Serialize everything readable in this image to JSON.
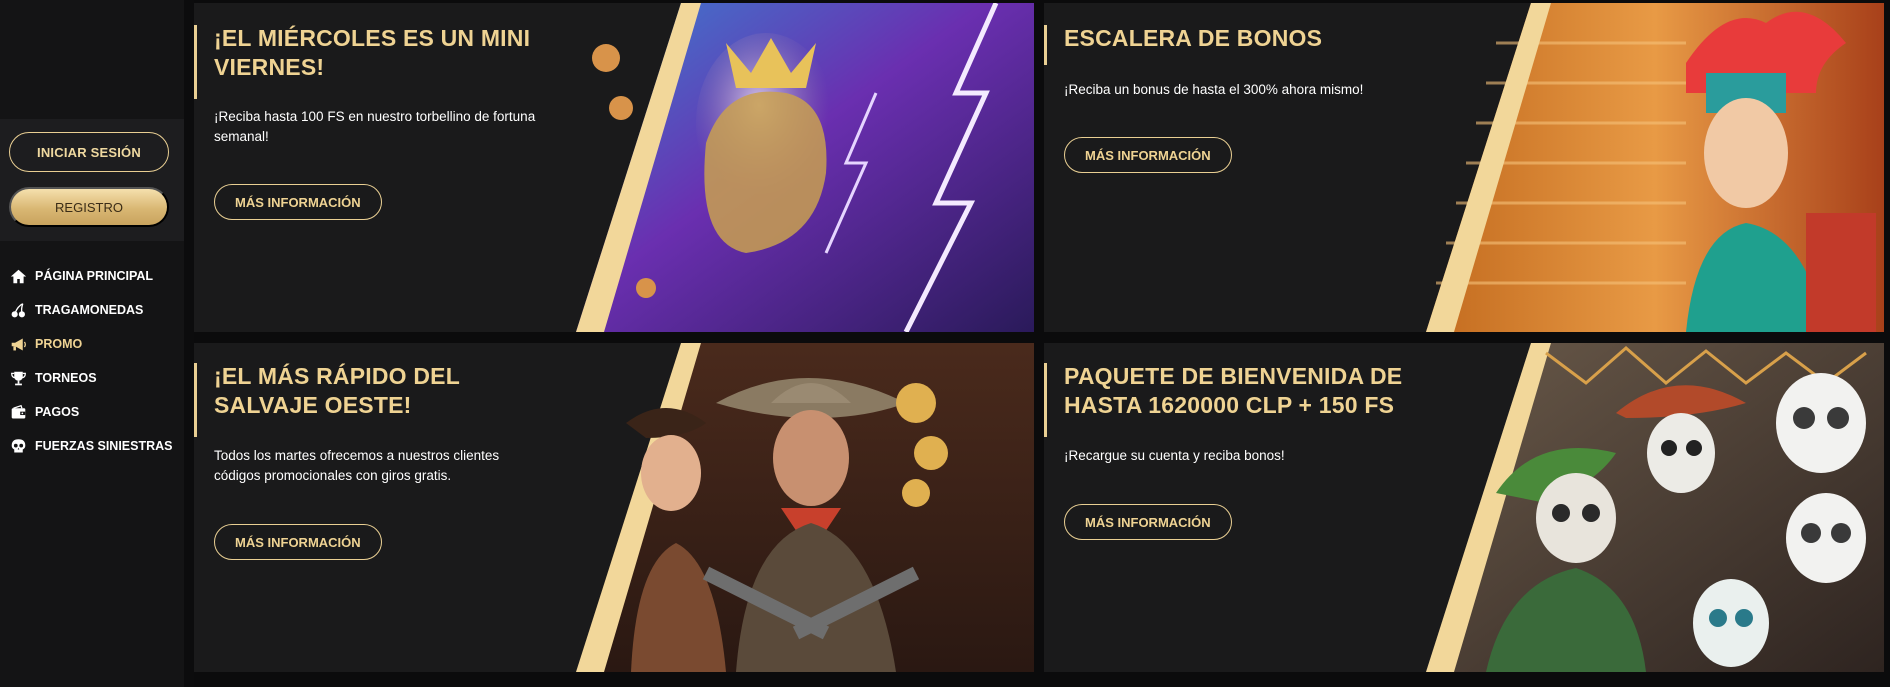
{
  "sidebar": {
    "login_label": "INICIAR SESIÓN",
    "register_label": "REGISTRO",
    "nav": [
      {
        "label": "PÁGINA PRINCIPAL",
        "icon": "home-icon",
        "active": false
      },
      {
        "label": "TRAGAMONEDAS",
        "icon": "cherries-icon",
        "active": false
      },
      {
        "label": "PROMO",
        "icon": "megaphone-icon",
        "active": true
      },
      {
        "label": "TORNEOS",
        "icon": "trophy-icon",
        "active": false
      },
      {
        "label": "PAGOS",
        "icon": "wallet-icon",
        "active": false
      },
      {
        "label": "FUERZAS SINIESTRAS",
        "icon": "skull-icon",
        "active": false
      }
    ]
  },
  "promos": [
    {
      "title_line1": "¡EL MIÉRCOLES ES UN MINI",
      "title_line2": "VIERNES!",
      "desc_line1": "¡Reciba hasta 100 FS en nuestro torbellino de fortuna",
      "desc_line2": "semanal!",
      "button": "MÁS INFORMACIÓN",
      "art": "zeus-lightning-image"
    },
    {
      "title_line1": "ESCALERA DE BONOS",
      "title_line2": "",
      "desc_line1": "¡Reciba un bonus de hasta el 300% ahora mismo!",
      "desc_line2": "",
      "button": "MÁS INFORMACIÓN",
      "art": "aztec-princess-image"
    },
    {
      "title_line1": "¡EL MÁS RÁPIDO DEL",
      "title_line2": "SALVAJE OESTE!",
      "desc_line1": "Todos los martes ofrecemos a nuestros clientes",
      "desc_line2": "códigos promocionales con giros gratis.",
      "button": "MÁS INFORMACIÓN",
      "art": "cowboy-gunslinger-image"
    },
    {
      "title_line1": "PAQUETE DE BIENVENIDA DE",
      "title_line2": "HASTA 1620000 CLP + 150 FS",
      "desc_line1": "¡Recargue su cuenta y reciba bonos!",
      "desc_line2": "",
      "button": "MÁS INFORMACIÓN",
      "art": "mariachi-skeletons-image"
    }
  ],
  "colors": {
    "gold": "#efd393",
    "card_bg": "#1a1a1b",
    "sidebar_bg": "#141415"
  }
}
